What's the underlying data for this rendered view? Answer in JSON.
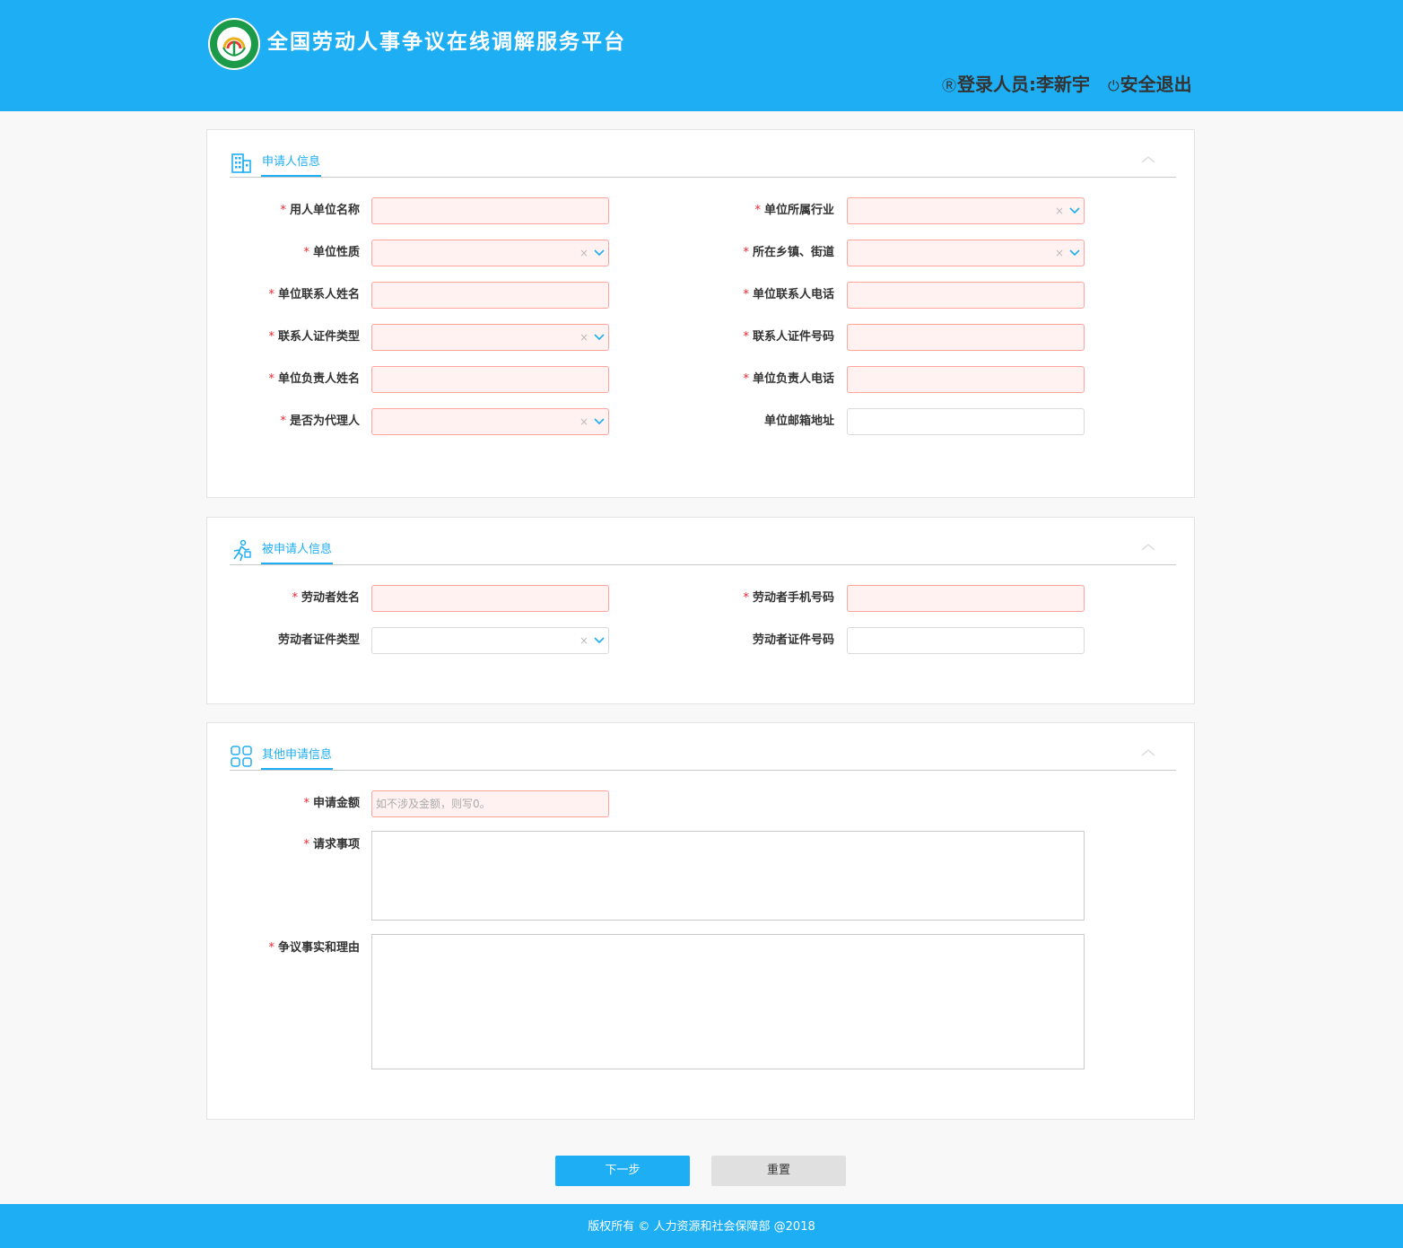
{
  "header": {
    "title": "全国劳动人事争议在线调解服务平台",
    "user_label": "登录人员:李新宇",
    "logout_label": "安全退出",
    "user_icon": "user-circle-icon",
    "logout_icon": "power-icon",
    "brand_color": "#1eaef3"
  },
  "applicant": {
    "title": "申请人信息",
    "icon": "building-icon",
    "fields": [
      {
        "label": "用人单位名称",
        "required": true,
        "type": "input",
        "value": ""
      },
      {
        "label": "单位所属行业",
        "required": true,
        "type": "select",
        "value": ""
      },
      {
        "label": "单位性质",
        "required": true,
        "type": "select",
        "value": ""
      },
      {
        "label": "所在乡镇、街道",
        "required": true,
        "type": "select",
        "value": ""
      },
      {
        "label": "单位联系人姓名",
        "required": true,
        "type": "input",
        "value": ""
      },
      {
        "label": "单位联系人电话",
        "required": true,
        "type": "input",
        "value": ""
      },
      {
        "label": "联系人证件类型",
        "required": true,
        "type": "select",
        "value": ""
      },
      {
        "label": "联系人证件号码",
        "required": true,
        "type": "input",
        "value": ""
      },
      {
        "label": "单位负责人姓名",
        "required": true,
        "type": "input",
        "value": ""
      },
      {
        "label": "单位负责人电话",
        "required": true,
        "type": "input",
        "value": ""
      },
      {
        "label": "是否为代理人",
        "required": true,
        "type": "select",
        "value": ""
      },
      {
        "label": "单位邮箱地址",
        "required": false,
        "type": "input",
        "value": ""
      }
    ]
  },
  "respondent": {
    "title": "被申请人信息",
    "icon": "walking-person-icon",
    "fields": [
      {
        "label": "劳动者姓名",
        "required": true,
        "type": "input",
        "value": ""
      },
      {
        "label": "劳动者手机号码",
        "required": true,
        "type": "input",
        "value": ""
      },
      {
        "label": "劳动者证件类型",
        "required": false,
        "type": "select",
        "value": ""
      },
      {
        "label": "劳动者证件号码",
        "required": false,
        "type": "input",
        "value": ""
      }
    ]
  },
  "other": {
    "title": "其他申请信息",
    "icon": "grid-icon",
    "amount_label": "申请金额",
    "amount_placeholder": "如不涉及金额，则写0。",
    "request_label": "请求事项",
    "facts_label": "争议事实和理由"
  },
  "required_mark": "*",
  "select_clear": "×",
  "buttons": {
    "next": "下一步",
    "reset": "重置"
  },
  "footer": {
    "text": "版权所有 © 人力资源和社会保障部 @2018"
  }
}
